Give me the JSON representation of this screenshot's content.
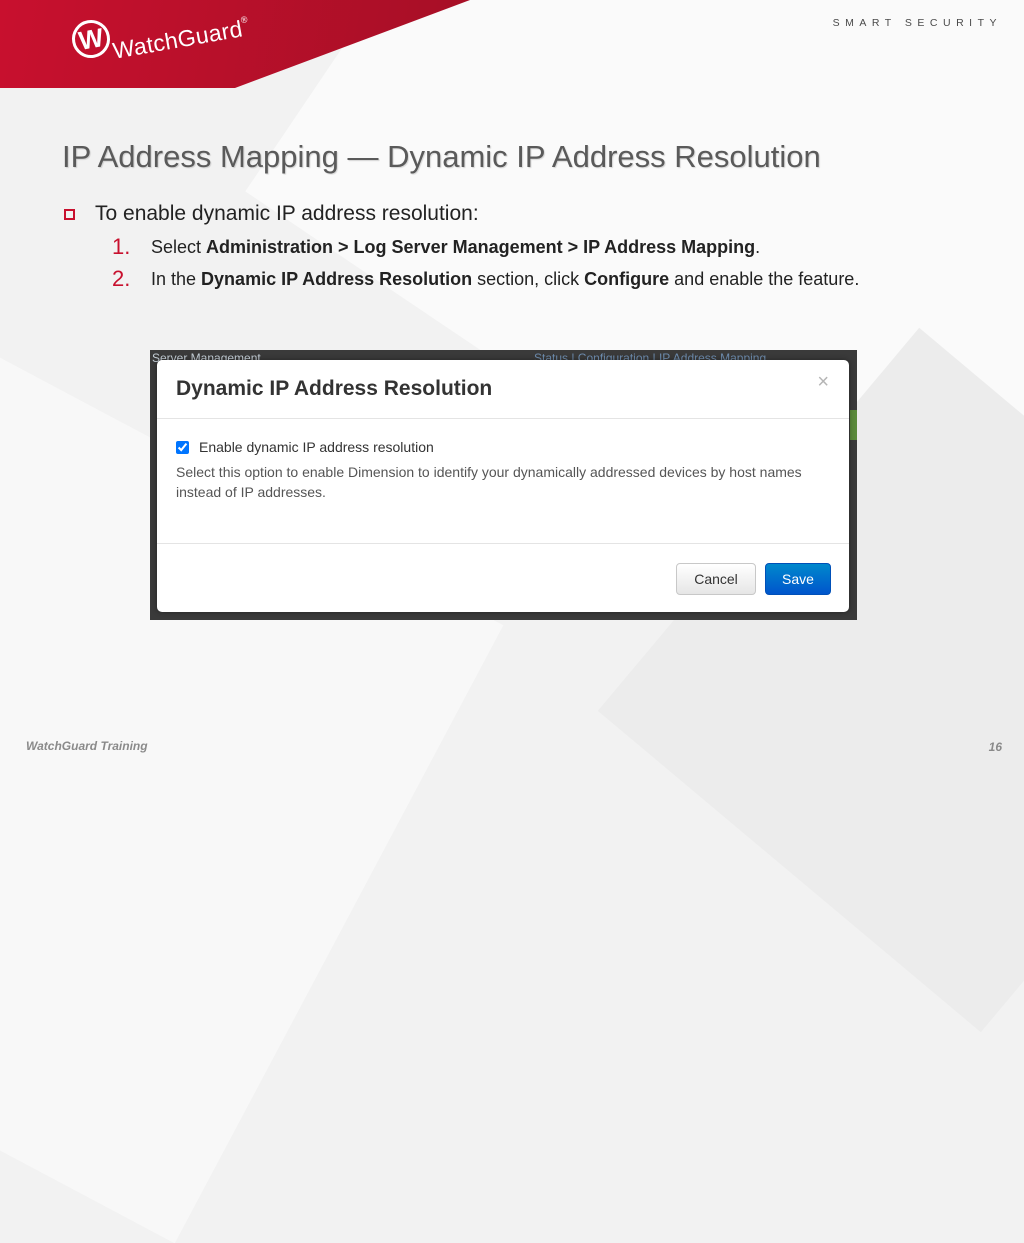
{
  "header": {
    "logo_text": "WatchGuard",
    "logo_reg": "®",
    "tagline": "SMART SECURITY"
  },
  "slide": {
    "title": "IP Address Mapping — Dynamic IP Address Resolution",
    "bullet": "To enable dynamic IP address resolution:",
    "steps": [
      {
        "num": "1.",
        "parts": [
          {
            "text": "Select ",
            "bold": false
          },
          {
            "text": "Administration > Log Server Management > IP Address Mapping",
            "bold": true
          },
          {
            "text": ".",
            "bold": false
          }
        ]
      },
      {
        "num": "2.",
        "parts": [
          {
            "text": "In the ",
            "bold": false
          },
          {
            "text": "Dynamic IP Address Resolution",
            "bold": true
          },
          {
            "text": " section, click ",
            "bold": false
          },
          {
            "text": "Configure",
            "bold": true
          },
          {
            "text": " and enable the feature.",
            "bold": false
          }
        ]
      }
    ]
  },
  "screenshot": {
    "bg_left": "Server Management",
    "bg_right": "Status | Configuration | IP Address Mapping",
    "dialog": {
      "title": "Dynamic IP Address Resolution",
      "close_glyph": "×",
      "checkbox_label": "Enable dynamic IP address resolution",
      "checkbox_checked": true,
      "help_text": "Select this option to enable Dimension to identify your dynamically addressed devices by host names instead of IP addresses.",
      "cancel_label": "Cancel",
      "save_label": "Save"
    }
  },
  "footer": {
    "left": "WatchGuard Training",
    "page_number": "16"
  },
  "colors": {
    "brand_red": "#c8102e",
    "save_blue": "#0066cc"
  }
}
